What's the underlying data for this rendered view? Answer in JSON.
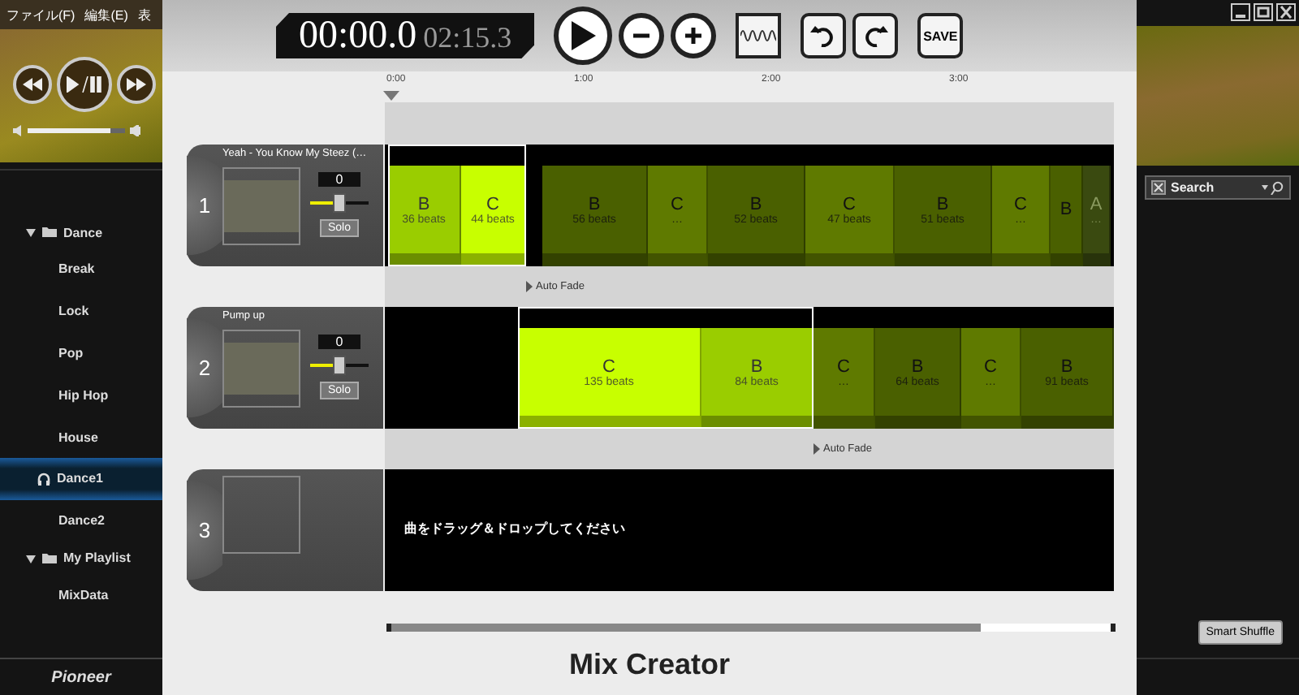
{
  "app": {
    "menu": [
      "ファイル(F)",
      "編集(E)",
      "表"
    ],
    "volume": {
      "level": 0.85
    },
    "sidebar": [
      {
        "label": "Dance",
        "kind": "folder",
        "expanded": true,
        "children": [
          {
            "label": "Break",
            "selected": false
          },
          {
            "label": "Lock",
            "selected": false
          },
          {
            "label": "Pop",
            "selected": false
          },
          {
            "label": "Hip Hop",
            "selected": false
          },
          {
            "label": "House",
            "selected": false
          },
          {
            "label": "Dance1",
            "selected": true
          },
          {
            "label": "Dance2",
            "selected": false
          }
        ]
      },
      {
        "label": "My Playlist",
        "kind": "folder",
        "expanded": true,
        "children": [
          {
            "label": "MixData",
            "selected": false
          }
        ]
      }
    ],
    "logo": "Pioneer",
    "search": {
      "placeholder": "Search"
    },
    "smart_shuffle": "Smart Shuffle"
  },
  "dialog": {
    "timer": {
      "elapsed": "00:00.0",
      "total": "02:15.3"
    },
    "save": "SAVE",
    "ruler": [
      "0:00",
      "1:00",
      "2:00",
      "3:00"
    ],
    "tracks": [
      {
        "number": "1",
        "title": "Yeah - You Know My Steez (…",
        "gain": "0",
        "level": 0.5,
        "solo": "Solo",
        "fade": "Auto Fade",
        "segments": [
          {
            "label": "B",
            "beats": "36 beats",
            "kind": "light",
            "selected": true
          },
          {
            "label": "C",
            "beats": "44 beats",
            "kind": "bright",
            "selected": true
          },
          {
            "label": "B",
            "beats": "56 beats",
            "kind": "dark",
            "selected": false
          },
          {
            "label": "C",
            "beats": "…",
            "kind": "mid",
            "selected": false
          },
          {
            "label": "B",
            "beats": "52 beats",
            "kind": "dark",
            "selected": false
          },
          {
            "label": "C",
            "beats": "47 beats",
            "kind": "mid",
            "selected": false
          },
          {
            "label": "B",
            "beats": "51 beats",
            "kind": "dark",
            "selected": false
          },
          {
            "label": "C",
            "beats": "…",
            "kind": "mid",
            "selected": false
          },
          {
            "label": "B",
            "kind": "dark",
            "selected": false
          },
          {
            "label": "A",
            "beats": "…",
            "kind": "faint",
            "selected": false
          }
        ]
      },
      {
        "number": "2",
        "title": "Pump up",
        "gain": "0",
        "level": 0.5,
        "solo": "Solo",
        "fade": "Auto Fade",
        "segments": [
          {
            "label": "C",
            "beats": "135 beats",
            "kind": "bright",
            "selected": true
          },
          {
            "label": "B",
            "beats": "84 beats",
            "kind": "light",
            "selected": true
          },
          {
            "label": "C",
            "beats": "…",
            "kind": "mid",
            "selected": false
          },
          {
            "label": "B",
            "beats": "64 beats",
            "kind": "dark",
            "selected": false
          },
          {
            "label": "C",
            "beats": "…",
            "kind": "mid",
            "selected": false
          },
          {
            "label": "B",
            "beats": "91 beats",
            "kind": "dark",
            "selected": false
          }
        ]
      },
      {
        "number": "3",
        "hint": "曲をドラッグ＆ドロップしてください"
      }
    ],
    "title": "Mix Creator"
  }
}
